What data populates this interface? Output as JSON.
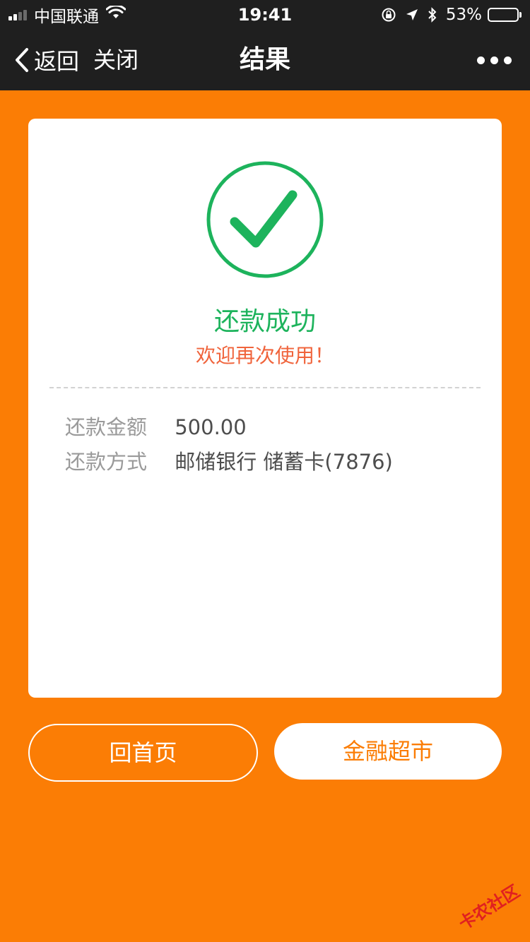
{
  "status_bar": {
    "carrier": "中国联通",
    "time": "19:41",
    "battery_text": "53%",
    "battery_level": 0.53,
    "battery_color": "#ffcc00",
    "signal_bars_filled": 2,
    "signal_bars_total": 4,
    "icons": [
      "wifi-icon",
      "rotation-lock-icon",
      "location-arrow-icon",
      "bluetooth-icon",
      "battery-icon"
    ]
  },
  "nav": {
    "back_label": "返回",
    "close_label": "关闭",
    "title": "结果",
    "more_icon": "more-icon"
  },
  "result": {
    "icon": "success-check-icon",
    "title": "还款成功",
    "subtitle": "欢迎再次使用！",
    "success_color": "#1db35c",
    "subtitle_color": "#f0643c"
  },
  "details": [
    {
      "label": "还款金额",
      "value": "500.00"
    },
    {
      "label": "还款方式",
      "value": "邮储银行 储蓄卡(7876)"
    }
  ],
  "buttons": {
    "home_label": "回首页",
    "market_label": "金融超市"
  },
  "watermark": "卡农社区",
  "colors": {
    "background": "#fb7d05",
    "bar": "#1f1f1f"
  }
}
